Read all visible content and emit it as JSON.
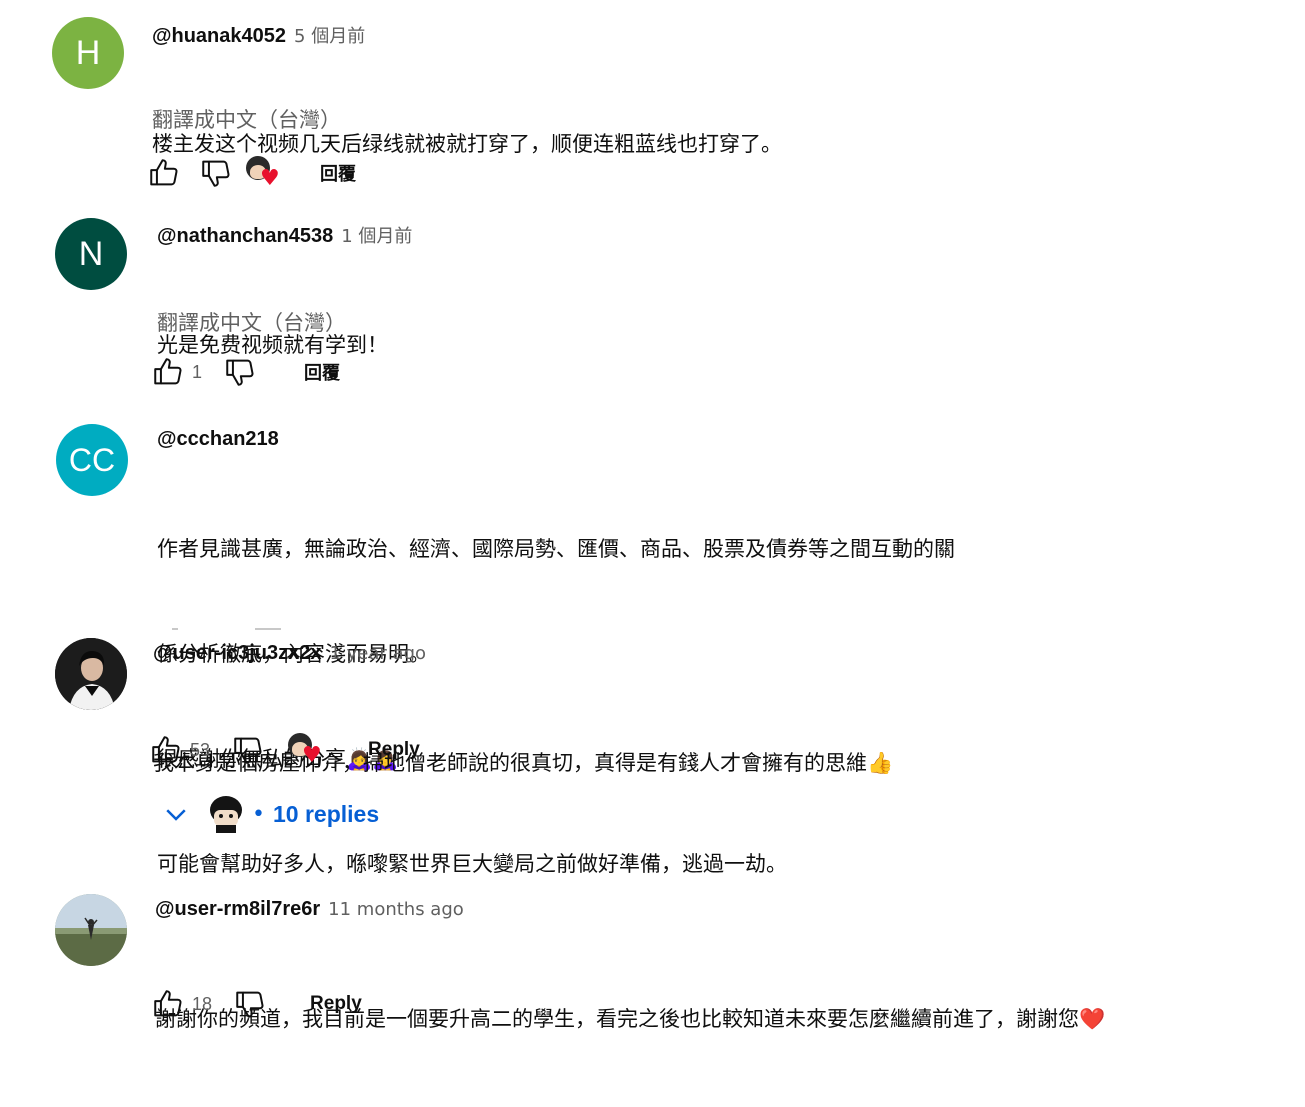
{
  "comments": [
    {
      "avatar_letter": "H",
      "avatar_color": "#7cb342",
      "handle": "@huanak4052",
      "time": "5 個月前",
      "lines": [
        "楼主发这个视频几天后绿线就被就打穿了，顺便连粗蓝线也打穿了。"
      ],
      "translate": "翻譯成中文（台灣）",
      "likes": "",
      "reply_label": "回覆",
      "creator_heart": true
    },
    {
      "avatar_letter": "N",
      "avatar_color": "#004d40",
      "handle": "@nathanchan4538",
      "time": "1 個月前",
      "lines": [
        "光是免费视频就有学到！"
      ],
      "translate": "翻譯成中文（台灣）",
      "likes": "1",
      "reply_label": "回覆",
      "creator_heart": false
    },
    {
      "avatar_letter": "CC",
      "avatar_color": "#00acc1",
      "handle": "@ccchan218",
      "time": "",
      "lines": [
        "作者見識甚廣，無論政治、經濟、國際局勢、匯價、商品、股票及債券等之間互動的關",
        "係分析徹底，內容淺而易明。",
        "很感謝你無私的分享🙇‍♀️🙇‍♀️",
        "可能會幫助好多人，喺嚟緊世界巨大變局之前做好準備，逃過一劫。"
      ]
    },
    {
      "avatar_letter": "",
      "avatar_color": "#1c1c1c",
      "handle": "@user-ic3ju3zx2x",
      "time": "1 year ago",
      "lines": [
        "我本身是個房屋仲介，掃地僧老師說的很真切，真得是有錢人才會擁有的思維👍"
      ],
      "likes": "53",
      "reply_label": "Reply",
      "creator_heart": true,
      "replies": "10 replies"
    },
    {
      "avatar_letter": "",
      "avatar_color": "#7a8a6a",
      "handle": "@user-rm8il7re6r",
      "time": "11 months ago",
      "lines": [
        "謝謝你的頻道，我目前是一個要升高二的學生，看完之後也比較知道未來要怎麼繼續前進了，謝謝您❤️"
      ],
      "likes": "18",
      "reply_label": "Reply",
      "creator_heart": false
    }
  ],
  "icons": {
    "like": "thumbs-up-icon",
    "dislike": "thumbs-down-icon",
    "heart": "creator-heart-icon",
    "expand": "chevron-down-icon"
  },
  "colors": {
    "link_blue": "#065fd4",
    "heart_red": "#e8112d",
    "secondary_text": "#606060"
  }
}
